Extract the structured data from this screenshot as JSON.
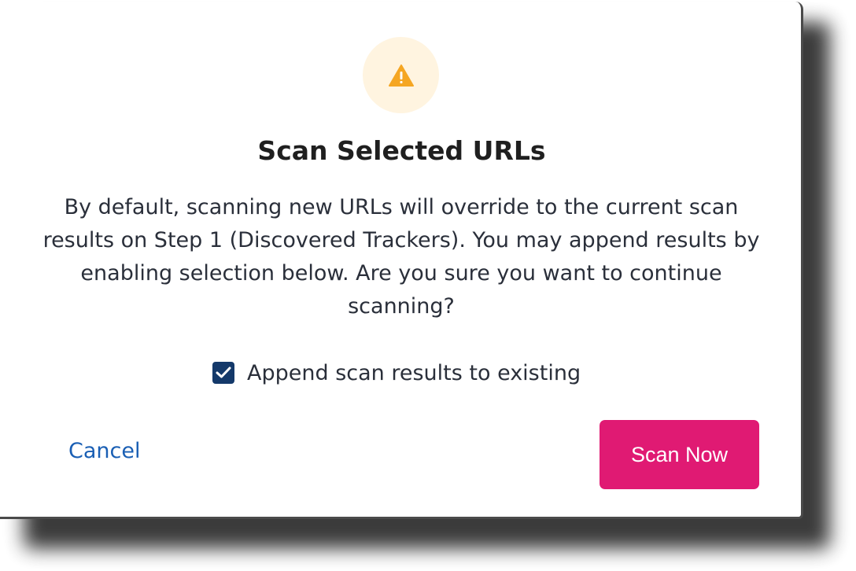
{
  "dialog": {
    "title": "Scan Selected URLs",
    "message": "By default, scanning new URLs will override to the current scan results on Step 1 (Discovered Trackers). You may append results by enabling selection below. Are you sure you want to continue scanning?",
    "icon": "warning-icon",
    "checkbox": {
      "label": "Append scan results to existing",
      "checked": true
    },
    "cancel_label": "Cancel",
    "confirm_label": "Scan Now"
  },
  "colors": {
    "warning": "#f5a623",
    "warning_bg": "#fff4e0",
    "primary_button": "#e01a73",
    "link": "#1a5fb4",
    "checkbox": "#14396a"
  }
}
